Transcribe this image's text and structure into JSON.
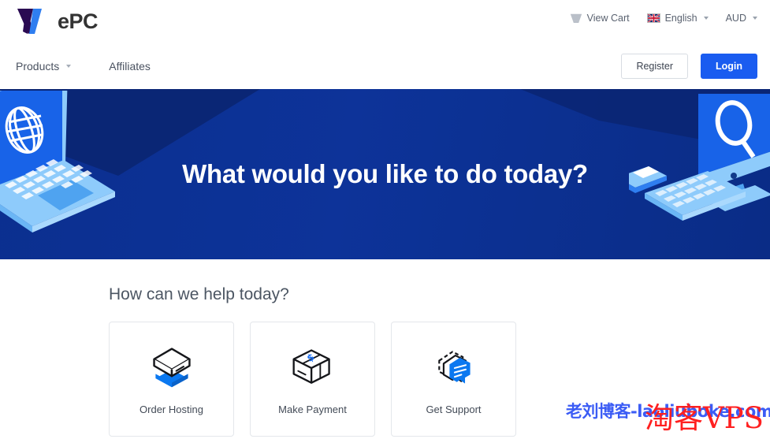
{
  "brand": {
    "logo_text": "ePC",
    "logo_icon": "wepc-w-mark",
    "color_dark": "#2a0a52",
    "color_blue": "#2f7ef0"
  },
  "topbar": {
    "cart": {
      "label": "View Cart",
      "icon": "cart-icon"
    },
    "language": {
      "label": "English",
      "flag": "uk-flag-icon",
      "caret": "chevron-down-icon"
    },
    "currency": {
      "label": "AUD",
      "caret": "chevron-down-icon"
    }
  },
  "mainnav": {
    "links": [
      {
        "label": "Products",
        "has_caret": true
      },
      {
        "label": "Affiliates",
        "has_caret": false
      }
    ],
    "register_label": "Register",
    "login_label": "Login",
    "login_color": "#1a5cf0"
  },
  "hero": {
    "title": "What would you like to do today?",
    "background_color": "#0d3399",
    "art_left": "isometric-laptop-globe",
    "art_right": "isometric-desktop-search"
  },
  "help": {
    "title": "How can we help today?",
    "cards": [
      {
        "label": "Order Hosting",
        "icon": "server-stack-icon"
      },
      {
        "label": "Make Payment",
        "icon": "money-box-icon"
      },
      {
        "label": "Get Support",
        "icon": "chat-bubbles-icon"
      }
    ]
  },
  "watermarks": {
    "blue": "老刘博客-laoliuboke.com",
    "blue_color": "#3b5cf5",
    "red": "淘客VPS",
    "red_color": "#ff2020"
  }
}
